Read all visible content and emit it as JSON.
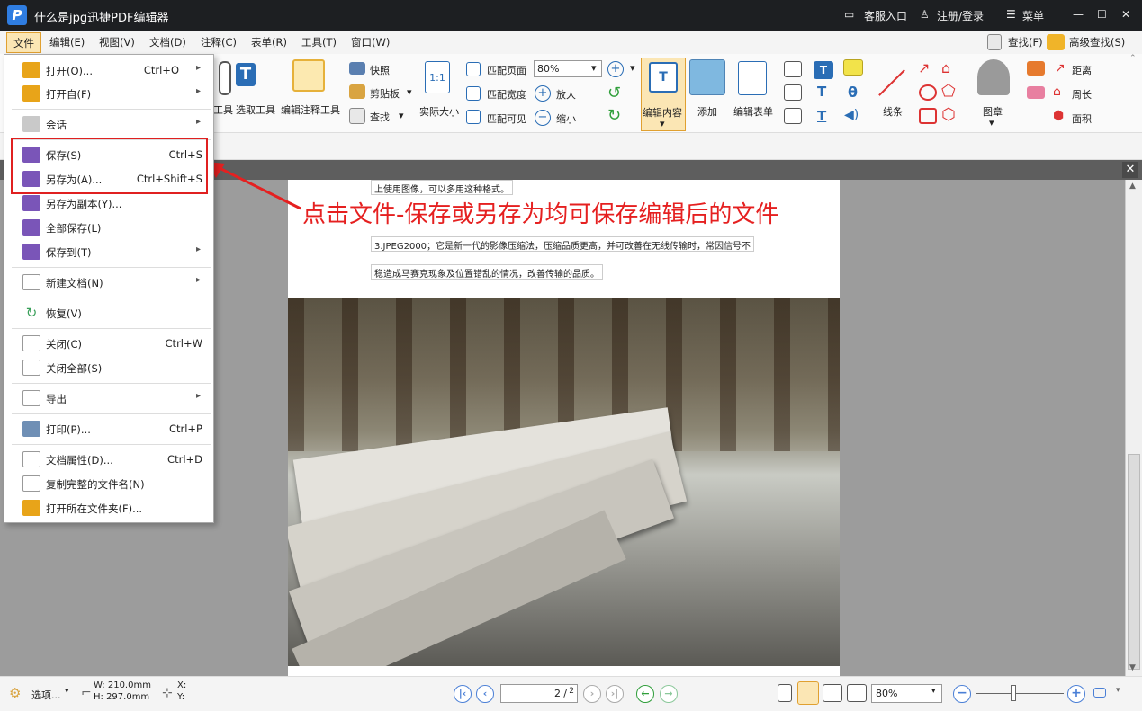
{
  "titlebar": {
    "logo": "P",
    "title": "什么是jpg迅捷PDF编辑器",
    "service": "客服入口",
    "login": "注册/登录",
    "menu": "菜单",
    "min": "—",
    "max": "☐",
    "close": "✕"
  },
  "menubar": {
    "items": [
      "文件",
      "编辑(E)",
      "视图(V)",
      "文档(D)",
      "注释(C)",
      "表单(R)",
      "工具(T)",
      "窗口(W)"
    ],
    "find": "查找(F)",
    "advanced_find": "高级查找(S)"
  },
  "ribbon": {
    "hand": "工具",
    "select_tool": "选取工具",
    "edit_annot_tool": "编辑注释工具",
    "snapshot": "快照",
    "clipboard": "剪贴板",
    "find": "查找",
    "actual_size_icon": "1:1",
    "actual_size": "实际大小",
    "fit_page": "匹配页面",
    "fit_width": "匹配宽度",
    "fit_visible": "匹配可见",
    "zoom_value": "80%",
    "zoom_in": "放大",
    "zoom_out": "缩小",
    "edit_content": "编辑内容",
    "add": "添加",
    "edit_form": "编辑表单",
    "lines": "线条",
    "stamp": "图章",
    "distance": "距离",
    "perimeter": "周长",
    "area": "面积"
  },
  "file_menu": {
    "items": [
      {
        "label": "打开(O)...",
        "shortcut": "Ctrl+O",
        "arrow": true,
        "color": "#e8a419"
      },
      {
        "label": "打开自(F)",
        "shortcut": "",
        "arrow": true,
        "color": "#e8a419"
      },
      {
        "label": "会话",
        "shortcut": "",
        "arrow": true,
        "color": "#c9c9c9"
      },
      {
        "label": "保存(S)",
        "shortcut": "Ctrl+S",
        "arrow": false,
        "color": "#7a55b8"
      },
      {
        "label": "另存为(A)...",
        "shortcut": "Ctrl+Shift+S",
        "arrow": false,
        "color": "#7a55b8"
      },
      {
        "label": "另存为副本(Y)...",
        "shortcut": "",
        "arrow": false,
        "color": "#7a55b8"
      },
      {
        "label": "全部保存(L)",
        "shortcut": "",
        "arrow": false,
        "color": "#7a55b8"
      },
      {
        "label": "保存到(T)",
        "shortcut": "",
        "arrow": true,
        "color": "#7a55b8"
      },
      {
        "label": "新建文档(N)",
        "shortcut": "",
        "arrow": true,
        "color": "#d8d8d8"
      },
      {
        "label": "恢复(V)",
        "shortcut": "",
        "arrow": false,
        "color": "#3aa05a"
      },
      {
        "label": "关闭(C)",
        "shortcut": "Ctrl+W",
        "arrow": false,
        "color": "#d8d8d8"
      },
      {
        "label": "关闭全部(S)",
        "shortcut": "",
        "arrow": false,
        "color": "#d8d8d8"
      },
      {
        "label": "导出",
        "shortcut": "",
        "arrow": true,
        "color": "#d8d8d8"
      },
      {
        "label": "打印(P)...",
        "shortcut": "Ctrl+P",
        "arrow": false,
        "color": "#6f8fb5"
      },
      {
        "label": "文档属性(D)...",
        "shortcut": "Ctrl+D",
        "arrow": false,
        "color": "#d8d8d8"
      },
      {
        "label": "复制完整的文件名(N)",
        "shortcut": "",
        "arrow": false,
        "color": "#d8d8d8"
      },
      {
        "label": "打开所在文件夹(F)...",
        "shortcut": "",
        "arrow": false,
        "color": "#e8a419"
      }
    ]
  },
  "document": {
    "line1": "上使用图像，可以多用这种格式。",
    "line2": "3.JPEG2000；它是新一代的影像压缩法，压缩品质更高，并可改善在无线传输时，常因信号不",
    "line3": "稳造成马赛克现象及位置错乱的情况，改善传输的品质。"
  },
  "annotation": "点击文件-保存或另存为均可保存编辑后的文件",
  "statusbar": {
    "options": "选项...",
    "width": "W: 210.0mm",
    "height": "H: 297.0mm",
    "x": "X:",
    "y": "Y:",
    "page_current": "2",
    "page_total": "2",
    "zoom": "80%"
  }
}
